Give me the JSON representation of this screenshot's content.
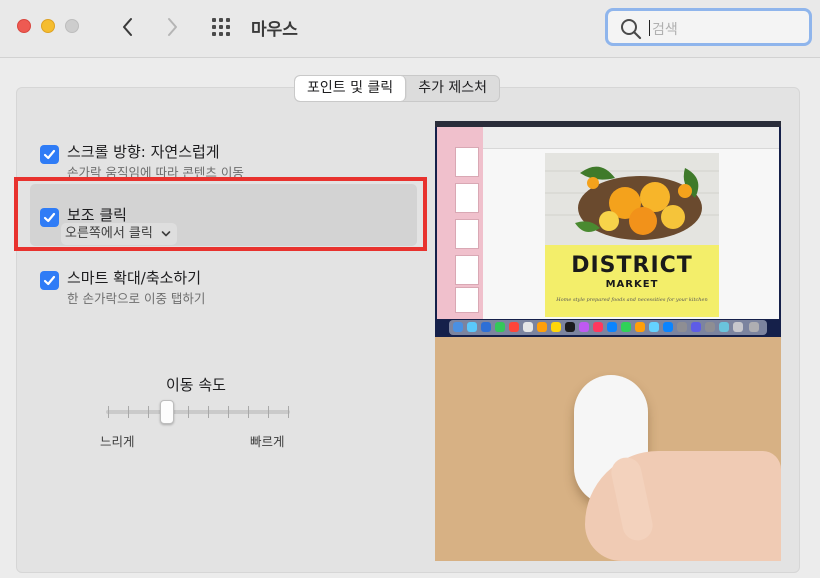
{
  "window": {
    "title": "마우스"
  },
  "search": {
    "placeholder": "검색"
  },
  "tabs": [
    {
      "label": "포인트 및 클릭",
      "selected": true
    },
    {
      "label": "추가 제스처",
      "selected": false
    }
  ],
  "options": [
    {
      "title": "스크롤 방향: 자연스럽게",
      "subtitle": "손가락 움직임에 따라 콘텐츠 이동",
      "checked": true
    },
    {
      "title": "보조 클릭",
      "popup_value": "오른쪽에서 클릭",
      "checked": true,
      "highlighted": true
    },
    {
      "title": "스마트 확대/축소하기",
      "subtitle": "한 손가락으로 이중 탭하기",
      "checked": true
    }
  ],
  "tracking_speed": {
    "label": "이동 속도",
    "min_label": "느리게",
    "max_label": "빠르게",
    "ticks": 10,
    "value_fraction": 0.33
  },
  "preview": {
    "poster_title": "DISTRICT",
    "poster_subtitle": "MARKET",
    "poster_tagline": "Home style prepared foods and necessities for your kitchen"
  },
  "colors": {
    "accent": "#2f7cf6",
    "highlight_border": "#e8322e",
    "search_ring": "#8fb5ec"
  },
  "icons": {
    "back": "chevron-left-icon",
    "forward": "chevron-right-icon",
    "show_all": "grid-icon",
    "search": "magnifier-icon",
    "checkbox": "checkmark-icon",
    "popup": "chevron-down-icon"
  }
}
